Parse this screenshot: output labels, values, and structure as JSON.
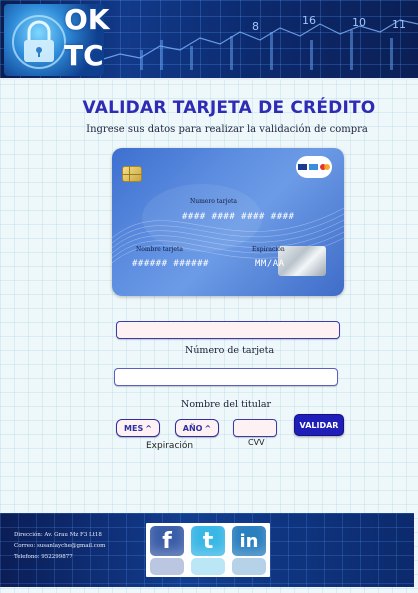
{
  "header": {
    "logo_line1": "OK",
    "logo_line2": "TC",
    "tick_labels": [
      "8",
      "16",
      "10",
      "11"
    ]
  },
  "main": {
    "title": "VALIDAR TARJETA DE CRÉDITO",
    "subtitle": "Ingrese sus datos para realizar la validación de compra"
  },
  "card": {
    "number_label": "Numero tarjeta",
    "number_value": "#### #### #### ####",
    "holder_label": "Nombre tarjeta",
    "holder_value": "###### ######",
    "expiry_label": "Expiración",
    "expiry_value": "MM/AA",
    "icons": [
      "chip-icon",
      "card-brands-icon",
      "hologram-icon"
    ]
  },
  "form": {
    "card_number_value": "",
    "card_number_caption": "Número de tarjeta",
    "holder_value": "",
    "holder_caption": "Nombre del titular",
    "month_label": "MES",
    "year_label": "AÑO",
    "caret": "^",
    "expiry_caption": "Expiración",
    "cvv_value": "",
    "cvv_caption": "CVV",
    "validate_label": "VALIDAR"
  },
  "footer": {
    "address": "Dirección: Av. Grau Mz F3 Lt18",
    "email": "Correo: susanlayche@gmail.com",
    "phone": "Telefono: 952299877",
    "social": [
      {
        "name": "facebook-icon",
        "glyph": "f",
        "color": "#3b5ea8"
      },
      {
        "name": "twitter-icon",
        "glyph": "t",
        "color": "#39b7e6"
      },
      {
        "name": "linkedin-icon",
        "glyph": "in",
        "color": "#2a7fbf"
      }
    ]
  },
  "colors": {
    "title": "#2f2bb5",
    "button": "#1f1eb8",
    "input_bg": "#fdf1f4",
    "banner": "#123a8a"
  }
}
